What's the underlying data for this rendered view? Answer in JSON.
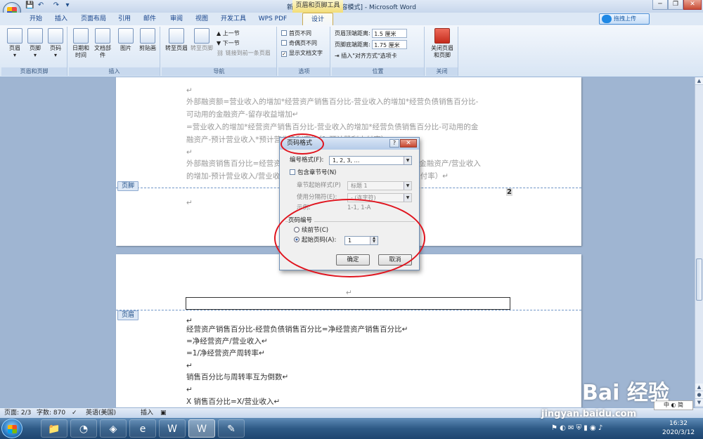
{
  "window": {
    "title": "新建 DOC 文档 [兼容模式] - Microsoft Word",
    "context_tab": "页眉和页脚工具",
    "controls": [
      "─",
      "❐",
      "✕"
    ]
  },
  "qat": [
    "💾",
    "↶",
    "↷",
    "▾"
  ],
  "tabs": [
    "开始",
    "插入",
    "页面布局",
    "引用",
    "邮件",
    "审阅",
    "视图",
    "开发工具",
    "WPS PDF",
    "设计"
  ],
  "cloud_upload": "拖拽上传",
  "ribbon": {
    "groups": [
      "页眉和页脚",
      "插入",
      "导航",
      "选项",
      "位置",
      "关闭"
    ],
    "hf": [
      "页眉",
      "页脚",
      "页码"
    ],
    "insert": [
      "日期和时间",
      "文档部件",
      "图片",
      "剪贴画"
    ],
    "nav_big": [
      "转至页眉",
      "转至页脚"
    ],
    "nav_small": [
      "上一节",
      "下一节",
      "链接到前一条页眉"
    ],
    "options": [
      "首页不同",
      "奇偶页不同",
      "显示文档文字"
    ],
    "pos_header": {
      "label": "页眉顶端距离:",
      "value": "1.5 厘米"
    },
    "pos_footer": {
      "label": "页脚底端距离:",
      "value": "1.75 厘米"
    },
    "pos_tab": "插入\"对齐方式\"选项卡",
    "close": "关闭页眉和页脚"
  },
  "doc": {
    "page1_lines": [
      "↵",
      "外部融资额=营业收入的增加*经营资产销售百分比-营业收入的增加*经营负债销售百分比-",
      "可动用的金融资产-留存收益增加↵",
      "=营业收入的增加*经营资产销售百分比-营业收入的增加*经营负债销售百分比-可动用的金",
      "融资产-预计营业收入*预计营业净利率*（1-预计股利支付率）↵",
      "↵",
      "外部融资销售百分比=经营资产销售百分比-经营负债销售百分比-可动用金融资产/营业收入",
      "的增加-预计营业收入/营业收入的增加*预计营业净利率*（1-预计股利支付率）↵"
    ],
    "footer_label": "页脚",
    "page_number": "2",
    "footer_mark": "↵",
    "page2_top_mark": "↵",
    "header_label": "页眉",
    "page2_lines": [
      "↵",
      "经营资产销售百分比-经营负债销售百分比=净经营资产销售百分比↵",
      "=净经营资产/营业收入↵",
      "=1/净经营资产周转率↵",
      "↵",
      "销售百分比与周转率互为倒数↵",
      "↵",
      "X 销售百分比=X/营业收入↵"
    ]
  },
  "dialog": {
    "title": "页码格式",
    "help": "?",
    "close": "✕",
    "format_label": "编号格式(F):",
    "format_value": "1, 2, 3, …",
    "include_chapter": "包含章节号(N)",
    "chapter_style_label": "章节起始样式(P)",
    "chapter_style_value": "标题 1",
    "separator_label": "使用分隔符(E):",
    "separator_value": "-  (连字符)",
    "example_label": "示例:",
    "example_value": "1-1, 1-A",
    "page_numbering": "页码编号",
    "continue": "续前节(C)",
    "start_at": "起始页码(A):",
    "start_value": "1",
    "ok": "确定",
    "cancel": "取消"
  },
  "status": {
    "page": "页面: 2/3",
    "words": "字数: 870",
    "lang": "英语(美国)",
    "mode": "插入"
  },
  "taskbar": {
    "time": "16:32",
    "date": "2020/3/12",
    "ime": "中 ◐ 简",
    "apps": [
      "📁",
      "◔",
      "◈",
      "e",
      "W",
      "Ｗ",
      "✎"
    ]
  },
  "watermark": {
    "logo": "Bai 经验",
    "url": "jingyan.baidu.com"
  }
}
